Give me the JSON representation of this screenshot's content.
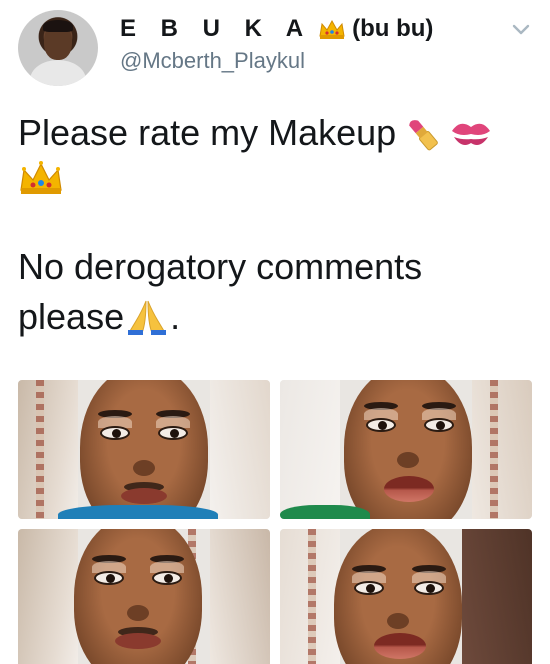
{
  "tweet": {
    "author": {
      "display_name": "E B U K A",
      "display_suffix": "(bu bu)",
      "handle": "@Mcberth_Playkul",
      "avatar": "avatar-photo",
      "name_emoji": "crown-emoji"
    },
    "text": {
      "line1": "Please rate my Makeup",
      "line1_emojis": [
        "lipstick-emoji",
        "kiss-mark-emoji",
        "crown-emoji"
      ],
      "line3": "No derogatory comments",
      "line4": "please",
      "line4_emoji": "folded-hands-emoji",
      "line4_tail": "."
    },
    "menu_icon": "chevron-down-icon",
    "media": [
      {
        "name": "photo-1",
        "description": "face-selfie"
      },
      {
        "name": "photo-2",
        "description": "face-selfie"
      },
      {
        "name": "photo-3",
        "description": "face-selfie"
      },
      {
        "name": "photo-4",
        "description": "face-selfie"
      }
    ]
  },
  "colors": {
    "text_primary": "#14171a",
    "text_secondary": "#657786",
    "caret": "#aab8c2",
    "background": "#ffffff"
  }
}
